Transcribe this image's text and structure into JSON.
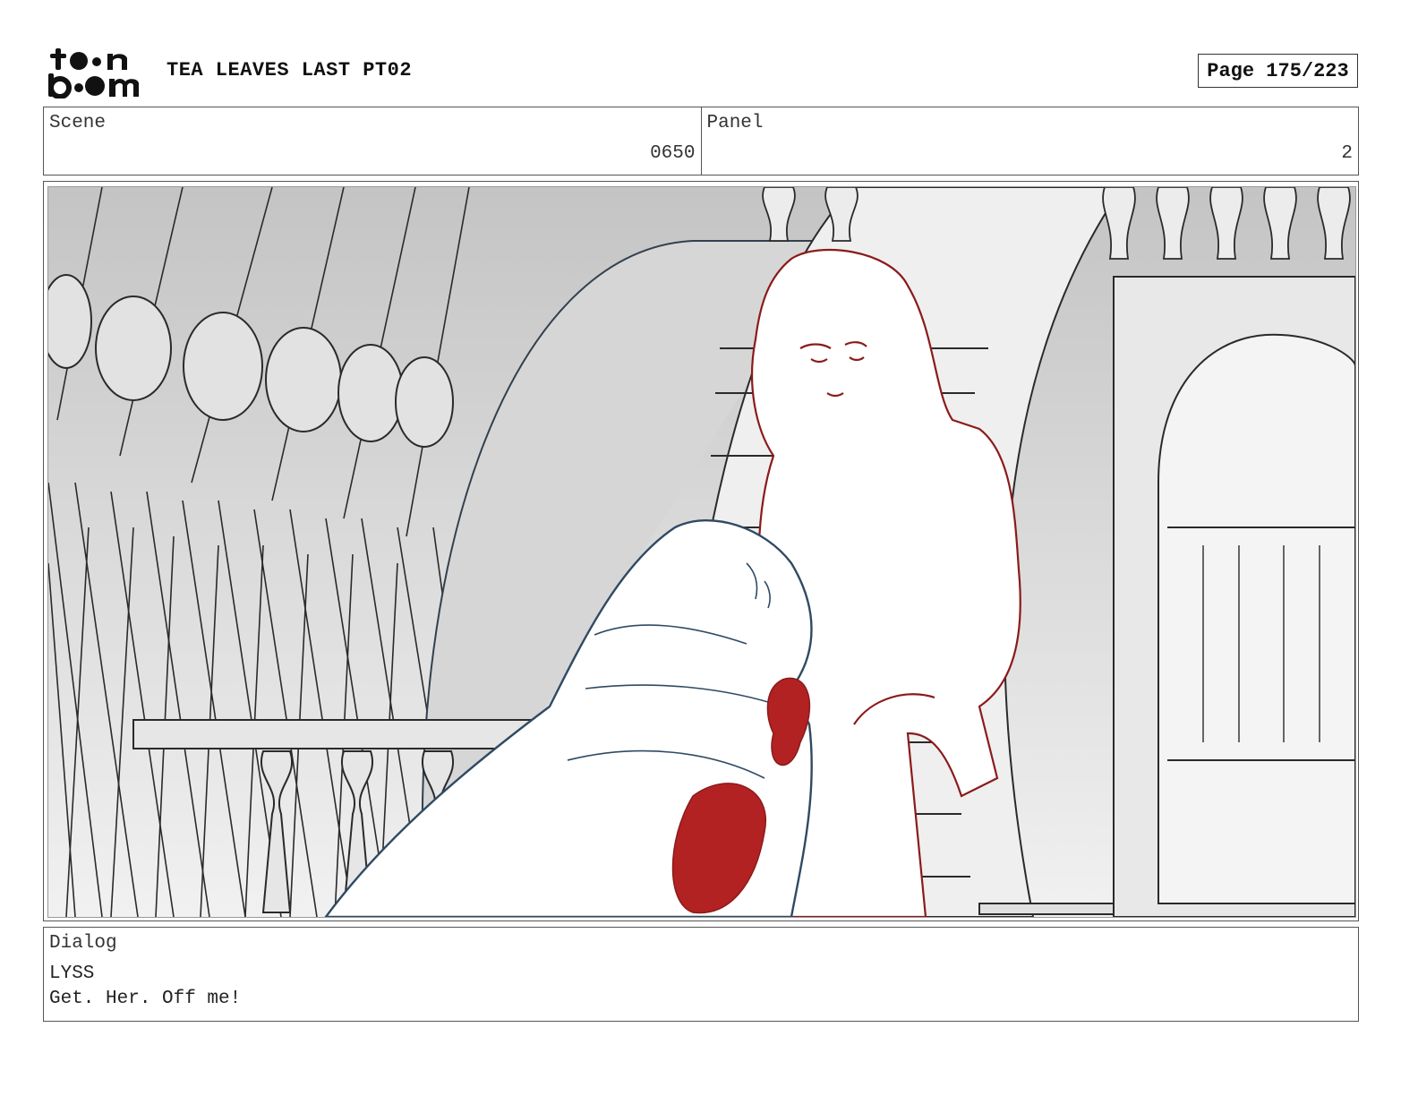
{
  "header": {
    "logo_text": "toon boom",
    "title": "TEA LEAVES LAST PT02",
    "page": "Page 175/223"
  },
  "scene": {
    "label": "Scene",
    "value": "0650"
  },
  "panel": {
    "label": "Panel",
    "value": "2"
  },
  "dialog": {
    "label": "Dialog",
    "speaker": "LYSS",
    "line": "Get. Her. Off me!"
  },
  "colors": {
    "red_character": "#8b1a1a",
    "red_fill": "#b22222",
    "blue_character": "#2f4a63",
    "background_line": "#2a2a2a"
  }
}
